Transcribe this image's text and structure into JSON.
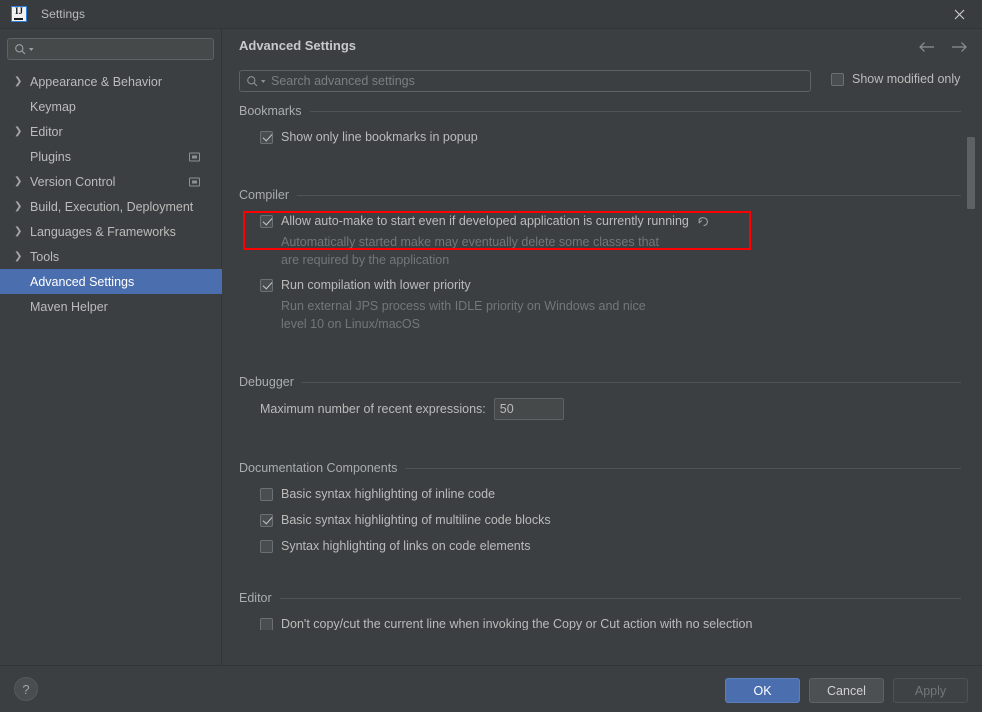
{
  "window": {
    "title": "Settings",
    "logo_icon": "intellij-idea-logo",
    "close_icon": "close-icon"
  },
  "sidebar": {
    "search": {
      "value": "",
      "placeholder": "",
      "icon": "search-icon"
    },
    "items": [
      {
        "label": "Appearance & Behavior",
        "expandable": true,
        "selected": false,
        "project_icon": false
      },
      {
        "label": "Keymap",
        "expandable": false,
        "selected": false,
        "project_icon": false
      },
      {
        "label": "Editor",
        "expandable": true,
        "selected": false,
        "project_icon": false
      },
      {
        "label": "Plugins",
        "expandable": false,
        "selected": false,
        "project_icon": true
      },
      {
        "label": "Version Control",
        "expandable": true,
        "selected": false,
        "project_icon": true
      },
      {
        "label": "Build, Execution, Deployment",
        "expandable": true,
        "selected": false,
        "project_icon": false
      },
      {
        "label": "Languages & Frameworks",
        "expandable": true,
        "selected": false,
        "project_icon": false
      },
      {
        "label": "Tools",
        "expandable": true,
        "selected": false,
        "project_icon": false
      },
      {
        "label": "Advanced Settings",
        "expandable": false,
        "selected": true,
        "project_icon": false
      },
      {
        "label": "Maven Helper",
        "expandable": false,
        "selected": false,
        "project_icon": false
      }
    ]
  },
  "main": {
    "page_title": "Advanced Settings",
    "nav_back_icon": "arrow-left-icon",
    "nav_forward_icon": "arrow-forward-icon",
    "search": {
      "value": "",
      "placeholder": "Search advanced settings",
      "icon": "search-icon"
    },
    "show_modified_only": {
      "label": "Show modified only",
      "checked": false
    },
    "groups": [
      {
        "title": "Bookmarks",
        "rows": [
          {
            "type": "checkbox",
            "label": "Show only line bookmarks in popup",
            "checked": true
          }
        ]
      },
      {
        "title": "Compiler",
        "rows": [
          {
            "type": "checkbox",
            "label": "Allow auto-make to start even if developed application is currently running",
            "checked": true,
            "revert_icon": "revert-icon",
            "highlighted": true
          },
          {
            "type": "description",
            "lines": [
              "Automatically started make may eventually delete some classes that",
              "are required by the application"
            ]
          },
          {
            "type": "checkbox",
            "label": "Run compilation with lower priority",
            "checked": true
          },
          {
            "type": "description",
            "lines": [
              "Run external JPS process with IDLE priority on Windows and nice",
              "level 10 on Linux/macOS"
            ]
          }
        ]
      },
      {
        "title": "Debugger",
        "rows": [
          {
            "type": "field",
            "label": "Maximum number of recent expressions:",
            "value": "50"
          }
        ]
      },
      {
        "title": "Documentation Components",
        "rows": [
          {
            "type": "checkbox",
            "label": "Basic syntax highlighting of inline code",
            "checked": false
          },
          {
            "type": "checkbox",
            "label": "Basic syntax highlighting of multiline code blocks",
            "checked": true
          },
          {
            "type": "checkbox",
            "label": "Syntax highlighting of links on code elements",
            "checked": false
          }
        ]
      },
      {
        "title": "Editor",
        "rows": [
          {
            "type": "checkbox",
            "label": "Don't copy/cut the current line when invoking the Copy or Cut action with no selection",
            "checked": false
          }
        ]
      }
    ]
  },
  "footer": {
    "help_label": "?",
    "ok_label": "OK",
    "cancel_label": "Cancel",
    "apply_label": "Apply",
    "apply_disabled": true
  },
  "annotation": {
    "highlight_color": "#ff0000"
  }
}
